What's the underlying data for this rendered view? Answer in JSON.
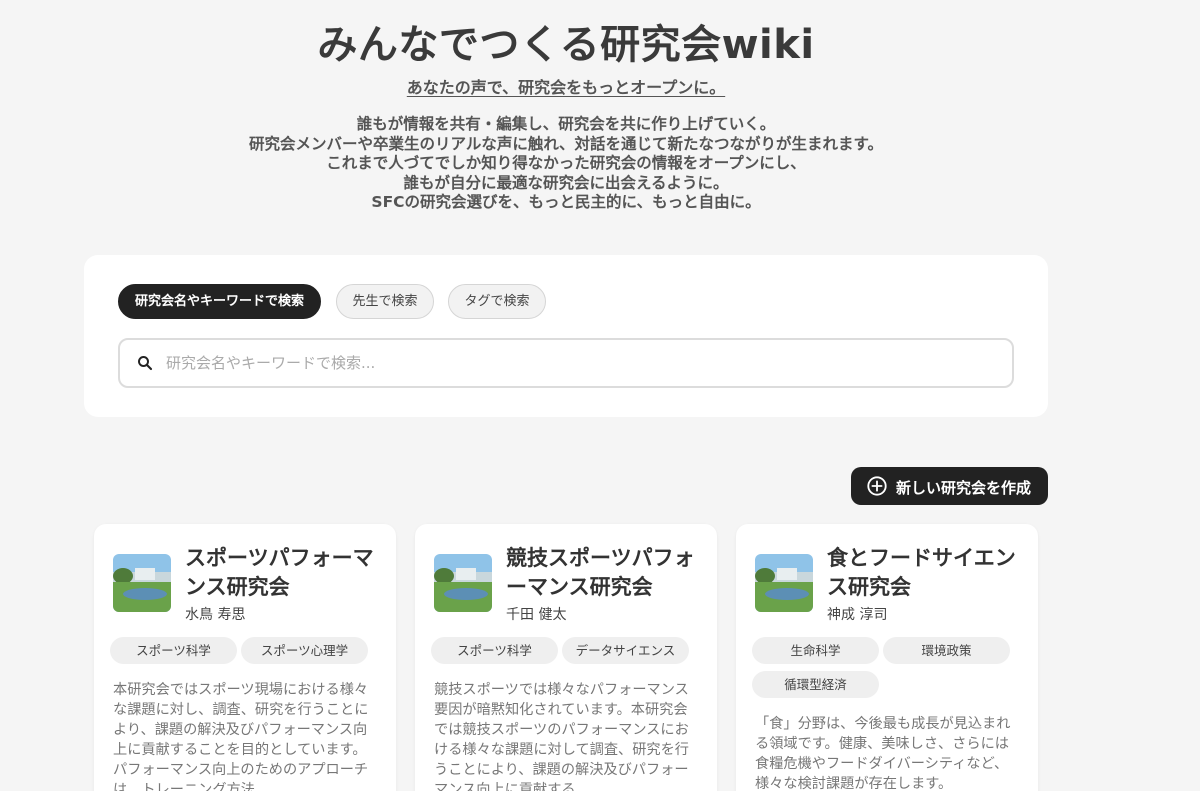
{
  "header": {
    "title": "みんなでつくる研究会wiki",
    "tagline": "あなたの声で、研究会をもっとオープンに。",
    "intro_lines": [
      "誰もが情報を共有・編集し、研究会を共に作り上げていく。",
      "研究会メンバーや卒業生のリアルな声に触れ、対話を通じて新たなつながりが生まれます。",
      "これまで人づてでしか知り得なかった研究会の情報をオープンにし、",
      "誰もが自分に最適な研究会に出会えるように。",
      "SFCの研究会選びを、もっと民主的に、もっと自由に。"
    ]
  },
  "search": {
    "tabs": [
      {
        "label": "研究会名やキーワードで検索",
        "active": true
      },
      {
        "label": "先生で検索",
        "active": false
      },
      {
        "label": "タグで検索",
        "active": false
      }
    ],
    "placeholder": "研究会名やキーワードで検索...",
    "value": "",
    "icon": "search-icon"
  },
  "create_button": {
    "label": "新しい研究会を作成",
    "icon": "plus-circle-icon"
  },
  "cards": [
    {
      "title": "スポーツパフォーマンス研究会",
      "professor": "水鳥 寿思",
      "tags": [
        "スポーツ科学",
        "スポーツ心理学"
      ],
      "description": "本研究会ではスポーツ現場における様々な課題に対し、調査、研究を行うことにより、課題の解決及びパフォーマンス向上に貢献することを目的としています。パフォーマンス向上のためのアプローチは、トレーニング方法"
    },
    {
      "title": "競技スポーツパフォーマンス研究会",
      "professor": "千田 健太",
      "tags": [
        "スポーツ科学",
        "データサイエンス"
      ],
      "description": "競技スポーツでは様々なパフォーマンス要因が暗黙知化されています。本研究会では競技スポーツのパフォーマンスにおける様々な課題に対して調査、研究を行うことにより、課題の解決及びパフォーマンス向上に貢献する"
    },
    {
      "title": "食とフードサイエンス研究会",
      "professor": "神成 淳司",
      "tags": [
        "生命科学",
        "環境政策",
        "循環型経済"
      ],
      "description": "「食」分野は、今後最も成長が見込まれる領域です。健康、美味しさ、さらには食糧危機やフードダイバーシティなど、様々な検討課題が存在します。"
    }
  ],
  "colors": {
    "background": "#f5f5f5",
    "primary_dark": "#222222",
    "tag_bg": "#efefef"
  }
}
